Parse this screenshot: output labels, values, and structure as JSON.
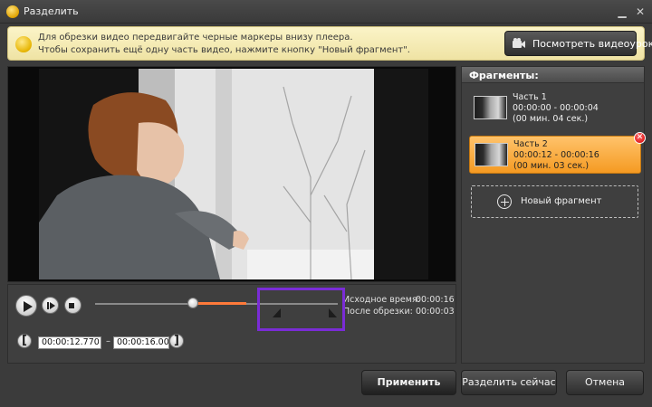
{
  "window": {
    "title": "Разделить",
    "close_glyph": "✕",
    "app_icon": "app-logo-icon"
  },
  "hint": {
    "line1": "Для обрезки видео передвигайте черные маркеры внизу плеера.",
    "line2": "Чтобы сохранить ещё одну часть видео, нажмите кнопку \"Новый фрагмент\".",
    "tutorial_button": "Посмотреть видеоурок",
    "tutorial_icon": "video-camera-icon"
  },
  "player": {
    "source_time_label": "Исходное время:",
    "source_time_value": "00:00:16",
    "after_trim_label": "После обрезки:",
    "after_trim_value": "00:00:03",
    "start_time": "00:00:12.770",
    "end_time": "00:00:16.000",
    "dash": "–",
    "start_bracket": "[",
    "end_bracket": "]",
    "playhead_fraction": 0.76,
    "selection_start_fraction": 0.76,
    "selection_end_fraction": 1.0
  },
  "fragments": {
    "header": "Фрагменты:",
    "items": [
      {
        "name": "Часть 1",
        "range": "00:00:00 - 00:00:04",
        "duration": "(00 мин. 04 сек.)",
        "selected": false
      },
      {
        "name": "Часть 2",
        "range": "00:00:12 - 00:00:16",
        "duration": "(00 мин. 03 сек.)",
        "selected": true
      }
    ],
    "new_fragment_label": "Новый фрагмент",
    "delete_glyph": "✕"
  },
  "buttons": {
    "apply": "Применить",
    "split_now": "Разделить сейчас",
    "cancel": "Отмена"
  },
  "colors": {
    "accent_orange": "#f59a22",
    "segment_orange": "#ff7a3a",
    "highlight_purple": "#7a2cd6",
    "hint_yellow": "#fbf4c8"
  }
}
